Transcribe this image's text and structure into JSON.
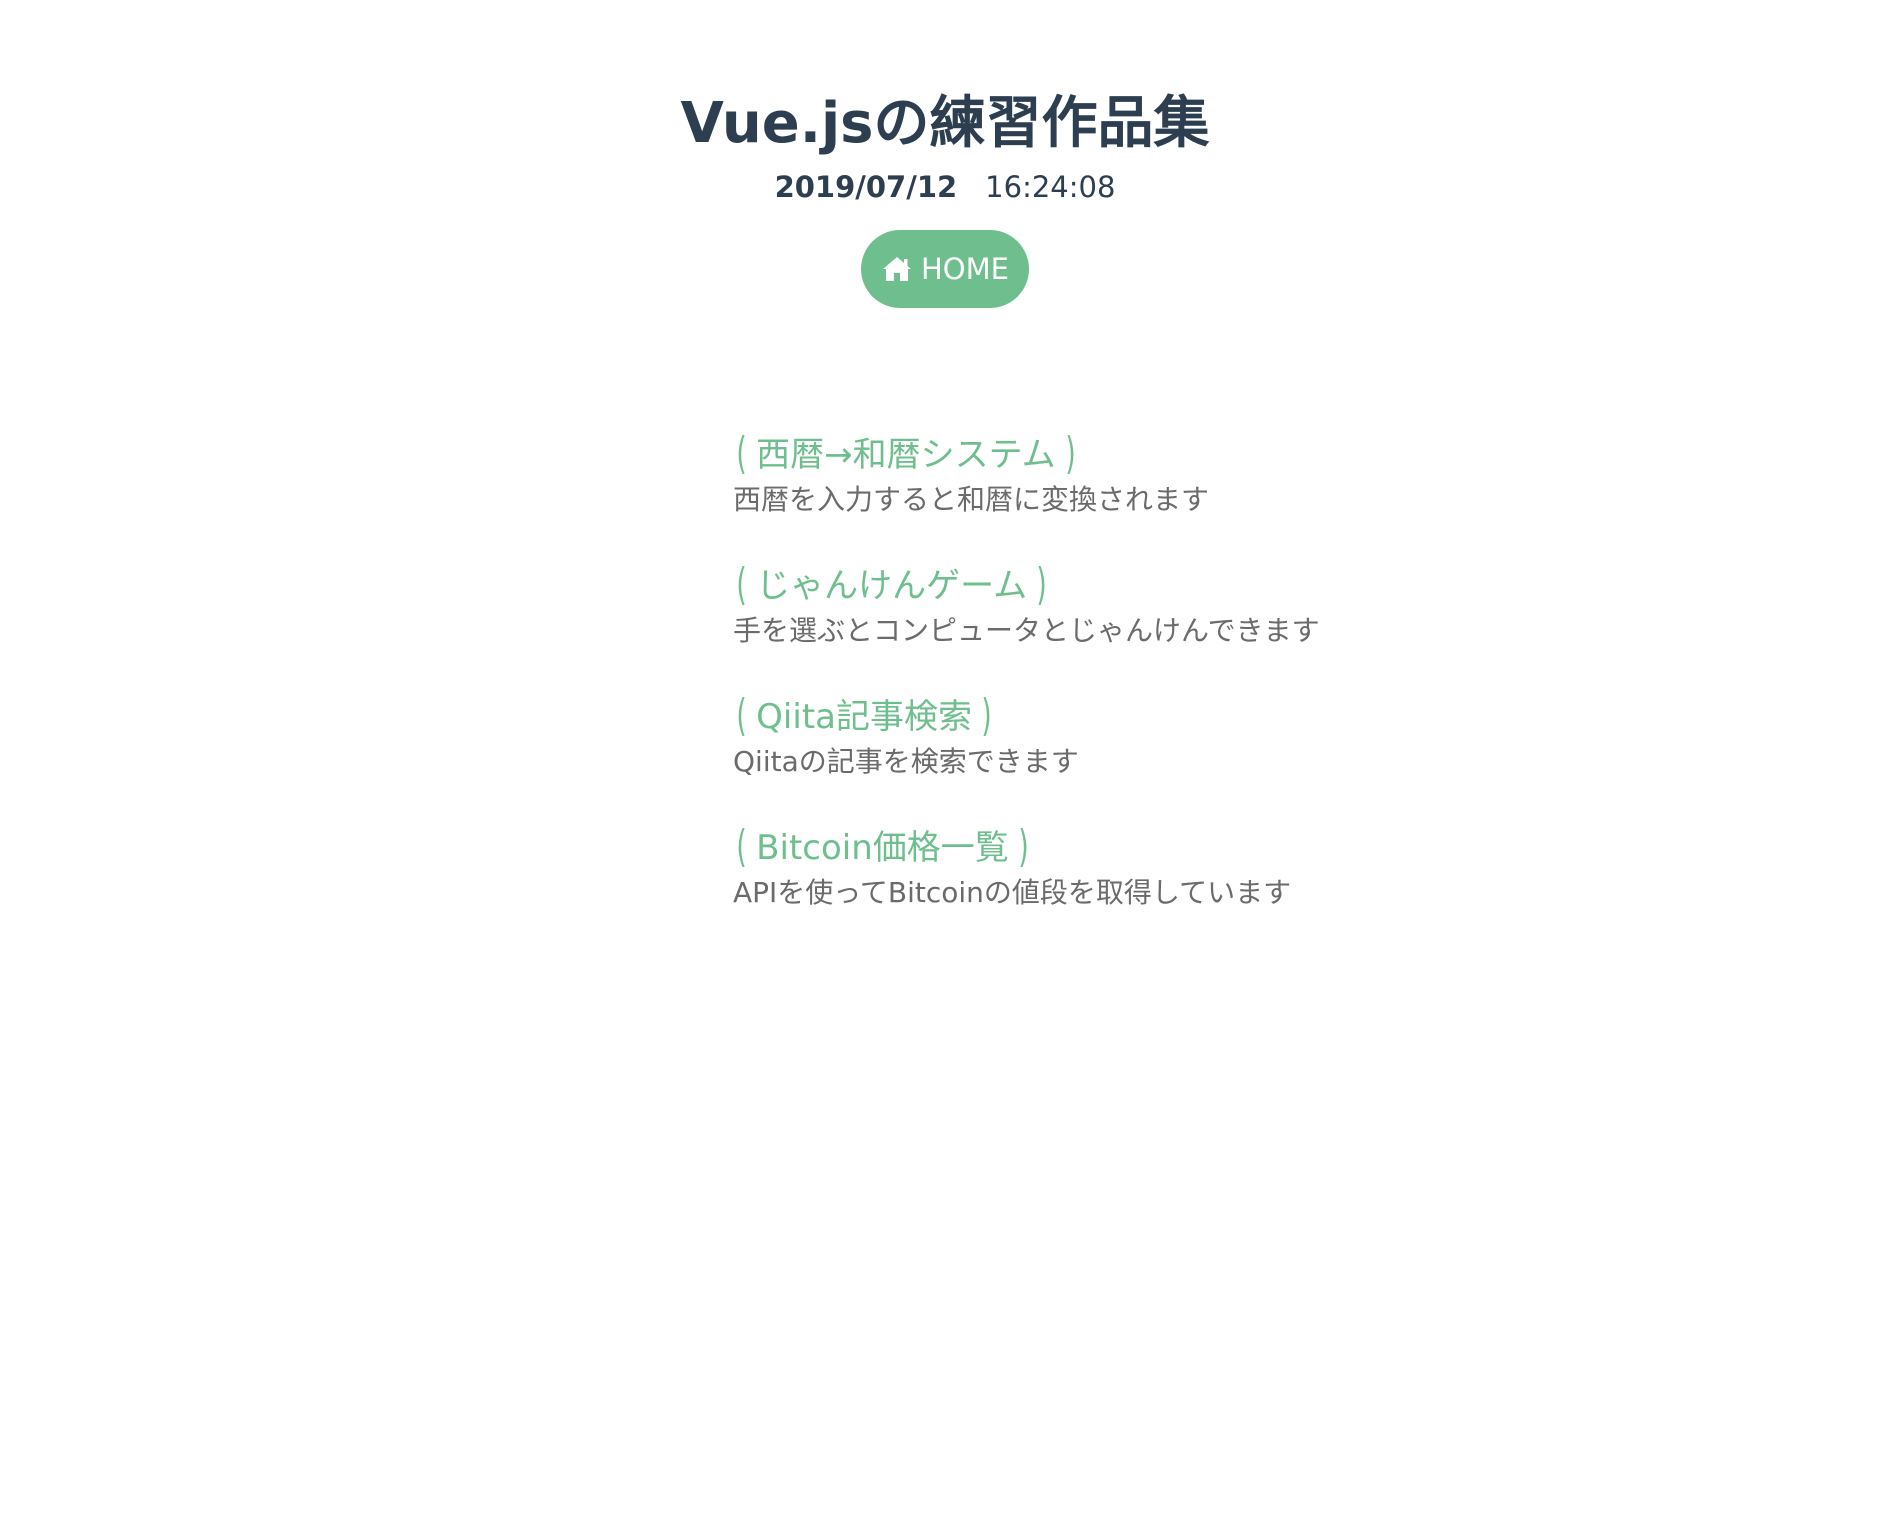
{
  "header": {
    "title": "Vue.jsの練習作品集",
    "date": "2019/07/12",
    "time": "16:24:08"
  },
  "nav": {
    "home_label": "HOME",
    "home_icon": "home-icon",
    "accent_color": "#6fbf8e"
  },
  "works": [
    {
      "title": "西暦→和暦システム",
      "description": "西暦を入力すると和暦に変換されます"
    },
    {
      "title": "じゃんけんゲーム",
      "description": "手を選ぶとコンピュータとじゃんけんできます"
    },
    {
      "title": "Qiita記事検索",
      "description": "Qiitaの記事を検索できます"
    },
    {
      "title": "Bitcoin価格一覧",
      "description": "APIを使ってBitcoinの値段を取得しています"
    }
  ]
}
